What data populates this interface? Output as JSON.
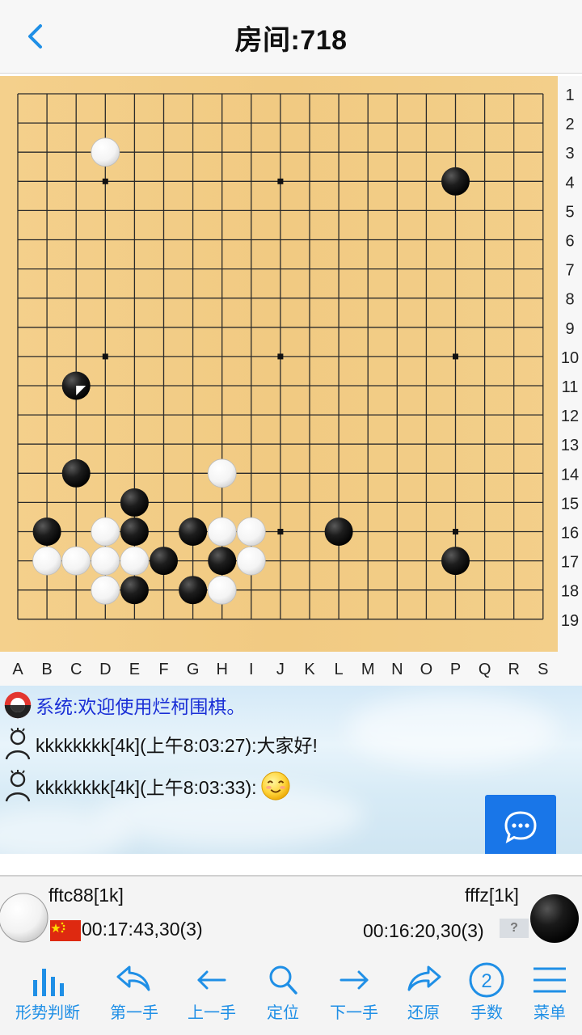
{
  "header": {
    "title": "房间:718",
    "back_icon": "chevron-left-icon"
  },
  "board": {
    "size": 19,
    "col_labels": [
      "A",
      "B",
      "C",
      "D",
      "E",
      "F",
      "G",
      "H",
      "I",
      "J",
      "K",
      "L",
      "M",
      "N",
      "O",
      "P",
      "Q",
      "R",
      "S"
    ],
    "row_labels": [
      "1",
      "2",
      "3",
      "4",
      "5",
      "6",
      "7",
      "8",
      "9",
      "10",
      "11",
      "12",
      "13",
      "14",
      "15",
      "16",
      "17",
      "18",
      "19"
    ],
    "hoshi": [
      "D4",
      "J4",
      "P4",
      "D10",
      "J10",
      "P10",
      "D16",
      "J16",
      "P16"
    ],
    "black_stones": [
      "P4",
      "C11",
      "C14",
      "E15",
      "B16",
      "E16",
      "G16",
      "L16",
      "F17",
      "H17",
      "P17",
      "E18",
      "G18"
    ],
    "white_stones": [
      "D3",
      "H14",
      "D16",
      "H16",
      "I16",
      "B17",
      "C17",
      "D17",
      "E17",
      "I17",
      "D18",
      "H18"
    ],
    "last_move": "C11",
    "colors": {
      "wood": "#f2cd86",
      "grid": "#2a2a2a",
      "label_bg": "#f7f7f7"
    }
  },
  "chat": {
    "messages": [
      {
        "speaker_icon": "system-logo-icon",
        "text": "系统:欢迎使用烂柯围棋。",
        "type": "system"
      },
      {
        "speaker_icon": "user-outline-icon",
        "text": "kkkkkkkk[4k](上午8:03:27):大家好!",
        "type": "user"
      },
      {
        "speaker_icon": "user-outline-icon",
        "text": "kkkkkkkk[4k](上午8:03:33):",
        "emoji": "smile-emoji-icon",
        "type": "user"
      }
    ],
    "send_button_icon": "chat-bubble-icon"
  },
  "players": {
    "white": {
      "name": "fftc88[1k]",
      "time": "00:17:43,30(3)",
      "flag": "china-flag-icon"
    },
    "black": {
      "name": "fffz[1k]",
      "time": "00:16:20,30(3)",
      "flag": "unknown-flag-icon",
      "flag_text": "?"
    }
  },
  "toolbar": [
    {
      "label": "形势判断",
      "icon": "bar-chart-icon"
    },
    {
      "label": "第一手",
      "icon": "reply-icon"
    },
    {
      "label": "上一手",
      "icon": "arrow-left-icon"
    },
    {
      "label": "定位",
      "icon": "search-icon"
    },
    {
      "label": "下一手",
      "icon": "arrow-right-icon"
    },
    {
      "label": "还原",
      "icon": "forward-icon"
    },
    {
      "label": "手数",
      "icon": "circle-number-icon",
      "icon_text": "2"
    },
    {
      "label": "菜单",
      "icon": "hamburger-menu-icon"
    }
  ],
  "accent": "#1f8fe6"
}
